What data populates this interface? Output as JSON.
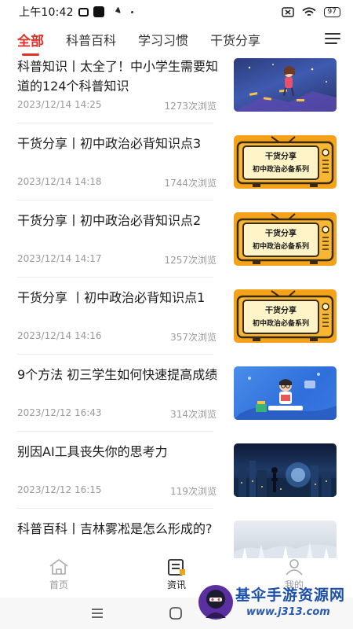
{
  "status_bar": {
    "time": "上午10:42",
    "battery": "97"
  },
  "tabs": [
    {
      "label": "全部",
      "active": true
    },
    {
      "label": "科普百科",
      "active": false
    },
    {
      "label": "学习习惯",
      "active": false
    },
    {
      "label": "干货分享",
      "active": false
    }
  ],
  "articles": [
    {
      "title": "科普知识丨太全了！中小学生需要知道的124个科普知识",
      "date": "2023/12/14 14:25",
      "views": "1273次浏览",
      "thumb": "kids-illustration"
    },
    {
      "title": "干货分享丨初中政治必背知识点3",
      "date": "2023/12/14 14:18",
      "views": "1744次浏览",
      "thumb": "tv-banner",
      "thumb_line1": "干货分享",
      "thumb_line2": "初中政治必备系列"
    },
    {
      "title": "干货分享丨初中政治必背知识点2",
      "date": "2023/12/14 14:17",
      "views": "1257次浏览",
      "thumb": "tv-banner",
      "thumb_line1": "干货分享",
      "thumb_line2": "初中政治必备系列"
    },
    {
      "title": "干货分享 丨初中政治必背知识点1",
      "date": "2023/12/14 14:16",
      "views": "357次浏览",
      "thumb": "tv-banner",
      "thumb_line1": "干货分享",
      "thumb_line2": "初中政治必备系列"
    },
    {
      "title": "9个方法 初三学生如何快速提高成绩",
      "date": "2023/12/12 16:43",
      "views": "314次浏览",
      "thumb": "study-illustration"
    },
    {
      "title": "别因AI工具丧失你的思考力",
      "date": "2023/12/12 16:15",
      "views": "119次浏览",
      "thumb": "ai-city"
    },
    {
      "title": "科普百科丨吉林雾凇是怎么形成的?",
      "date": "",
      "views": "",
      "thumb": "frost-trees"
    }
  ],
  "bottom_nav": [
    {
      "label": "首页",
      "icon": "home-icon",
      "active": false
    },
    {
      "label": "资讯",
      "icon": "news-icon",
      "active": true
    },
    {
      "label": "我的",
      "icon": "profile-icon",
      "active": false
    }
  ],
  "watermark": {
    "text": "基伞手游资源网",
    "url": "www.j313.com"
  },
  "colors": {
    "accent": "#e0312b",
    "tv_orange": "#f3a21a",
    "watermark_blue": "#1b4fa8"
  }
}
